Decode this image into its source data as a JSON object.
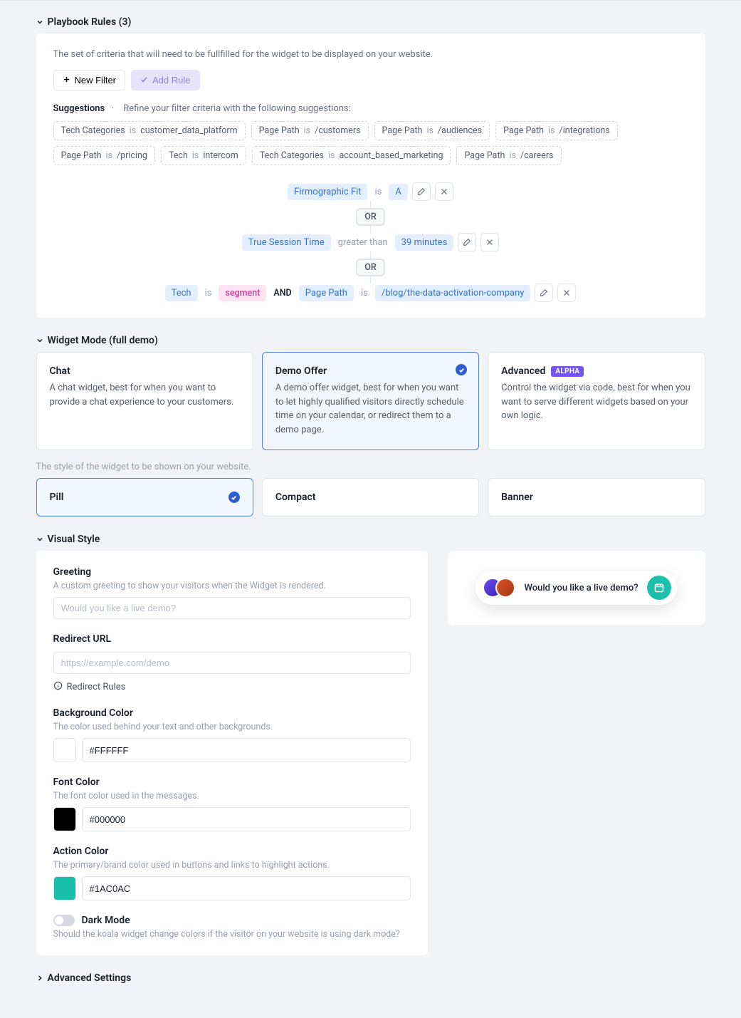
{
  "sections": {
    "rules_title": "Playbook Rules (3)",
    "widget_title": "Widget Mode (full demo)",
    "visual_title": "Visual Style",
    "advanced_title": "Advanced Settings"
  },
  "rules": {
    "description": "The set of criteria that will need to be fullfilled for the widget to be displayed on your website.",
    "new_filter_label": "New Filter",
    "add_rule_label": "Add Rule",
    "suggestions_label": "Suggestions",
    "suggestions_sep": "·",
    "suggestions_hint": "Refine your filter criteria with the following suggestions:",
    "suggestions": [
      {
        "key": "Tech Categories",
        "op": "is",
        "val": "customer_data_platform"
      },
      {
        "key": "Page Path",
        "op": "is",
        "val": "/customers"
      },
      {
        "key": "Page Path",
        "op": "is",
        "val": "/audiences"
      },
      {
        "key": "Page Path",
        "op": "is",
        "val": "/integrations"
      },
      {
        "key": "Page Path",
        "op": "is",
        "val": "/pricing"
      },
      {
        "key": "Tech",
        "op": "is",
        "val": "intercom"
      },
      {
        "key": "Tech Categories",
        "op": "is",
        "val": "account_based_marketing"
      },
      {
        "key": "Page Path",
        "op": "is",
        "val": "/careers"
      }
    ],
    "active": {
      "r1": {
        "key": "Firmographic Fit",
        "op": "is",
        "val": "A"
      },
      "or1": "OR",
      "r2": {
        "key": "True Session Time",
        "op": "greater than",
        "val": "39 minutes"
      },
      "or2": "OR",
      "r3a": {
        "key": "Tech",
        "op": "is",
        "val": "segment"
      },
      "and": "AND",
      "r3b": {
        "key": "Page Path",
        "op": "is",
        "val": "/blog/the-data-activation-company"
      }
    }
  },
  "modes": {
    "chat": {
      "title": "Chat",
      "desc": "A chat widget, best for when you want to provide a chat experience to your customers."
    },
    "demo": {
      "title": "Demo Offer",
      "desc": "A demo offer widget, best for when you want to let highly qualified visitors directly schedule time on your calendar, or redirect them to a demo page."
    },
    "advanced": {
      "title": "Advanced",
      "badge": "ALPHA",
      "desc": "Control the widget via code, best for when you want to serve different widgets based on your own logic."
    }
  },
  "style_hint": "The style of the widget to be shown on your website.",
  "styles": {
    "pill": "Pill",
    "compact": "Compact",
    "banner": "Banner"
  },
  "visual": {
    "greeting": {
      "label": "Greeting",
      "hint": "A custom greeting to show your visitors when the Widget is rendered.",
      "placeholder": "Would you like a live demo?"
    },
    "redirect": {
      "label": "Redirect URL",
      "placeholder": "https://example.com/demo",
      "rules_link": "Redirect Rules"
    },
    "bg": {
      "label": "Background Color",
      "hint": "The color used behind your text and other backgrounds.",
      "value": "#FFFFFF"
    },
    "font": {
      "label": "Font Color",
      "hint": "The font color used in the messages.",
      "value": "#000000"
    },
    "action": {
      "label": "Action Color",
      "hint": "The primary/brand color used in buttons and links to highlight actions.",
      "value": "#1AC0AC"
    },
    "dark": {
      "label": "Dark Mode",
      "hint": "Should the koala widget change colors if the visitor on your website is using dark mode?"
    }
  },
  "preview": {
    "text": "Would you like a live demo?",
    "action_color": "#1AC0AC"
  },
  "colors": {
    "bg_swatch": "#FFFFFF",
    "font_swatch": "#000000",
    "action_swatch": "#1AC0AC"
  }
}
